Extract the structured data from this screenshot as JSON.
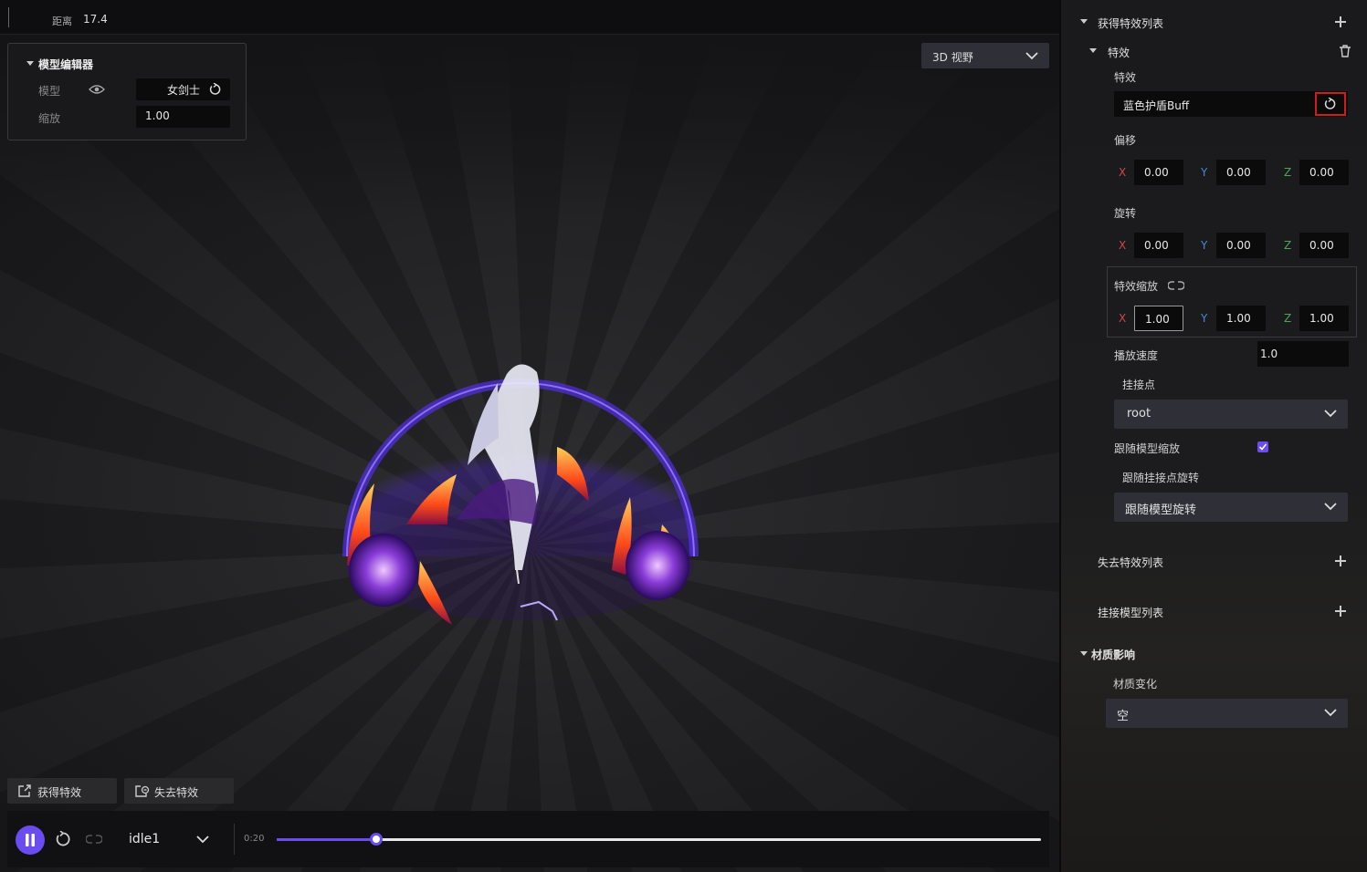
{
  "topbar": {
    "distance_label": "距离",
    "distance_value": "17.4"
  },
  "model_editor": {
    "title": "模型编辑器",
    "model_label": "模型",
    "model_value": "女剑士",
    "scale_label": "缩放",
    "scale_value": "1.00"
  },
  "view_dropdown": {
    "value": "3D 视野"
  },
  "effect_buttons": {
    "gain": "获得特效",
    "lose": "失去特效"
  },
  "playback": {
    "animation": "idle1",
    "time": "0:20",
    "progress": 0.13,
    "accent": "#6a4cf0"
  },
  "panel": {
    "gain_list_title": "获得特效列表",
    "effect_group_title": "特效",
    "effect_label": "特效",
    "effect_value": "蓝色护盾Buff",
    "offset_label": "偏移",
    "offset": {
      "x": "0.00",
      "y": "0.00",
      "z": "0.00"
    },
    "rotation_label": "旋转",
    "rotation": {
      "x": "0.00",
      "y": "0.00",
      "z": "0.00"
    },
    "scale_label": "特效缩放",
    "scale": {
      "x": "1.00",
      "y": "1.00",
      "z": "1.00"
    },
    "axis_x": "X",
    "axis_y": "Y",
    "axis_z": "Z",
    "speed_label": "播放速度",
    "speed_value": "1.0",
    "attach_label": "挂接点",
    "attach_value": "root",
    "follow_scale_label": "跟随模型缩放",
    "follow_scale_checked": true,
    "follow_rotation_label": "跟随挂接点旋转",
    "follow_rotation_value": "跟随模型旋转",
    "lose_list_title": "失去特效列表",
    "attach_models_title": "挂接模型列表",
    "material_title": "材质影响",
    "material_change_label": "材质变化",
    "material_change_value": "空",
    "highlight_color": "#d01c1c"
  }
}
